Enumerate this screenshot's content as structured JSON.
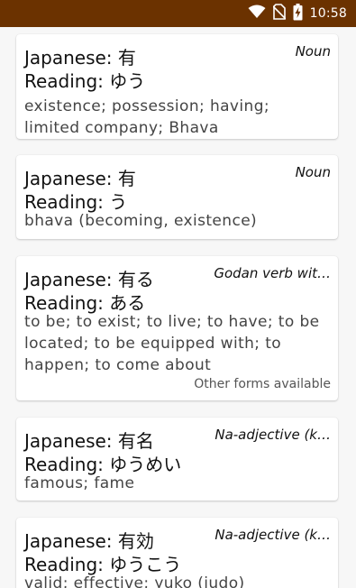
{
  "status_bar": {
    "time": "10:58",
    "icons": [
      "wifi-icon",
      "no-sim-icon",
      "battery-charging-icon"
    ]
  },
  "entries": [
    {
      "japanese": "Japanese: 有",
      "reading": "Reading: ゆう",
      "part_of_speech": "Noun",
      "meaning": "existence; possession; having; limited company; Bhava"
    },
    {
      "japanese": "Japanese: 有",
      "reading": "Reading: う",
      "part_of_speech": "Noun",
      "meaning": "bhava (becoming, existence)"
    },
    {
      "japanese": "Japanese: 有る",
      "reading": "Reading: ある",
      "part_of_speech": "Godan verb wit…",
      "meaning": "to be; to exist; to live; to have; to be located; to be equipped with; to happen; to come about",
      "other_forms": "Other forms available"
    },
    {
      "japanese": "Japanese: 有名",
      "reading": "Reading: ゆうめい",
      "part_of_speech": "Na-adjective (k…",
      "meaning": "famous; fame"
    },
    {
      "japanese": "Japanese: 有効",
      "reading": "Reading: ゆうこう",
      "part_of_speech": "Na-adjective (k…",
      "meaning": "valid; effective; yuko (judo)"
    }
  ]
}
